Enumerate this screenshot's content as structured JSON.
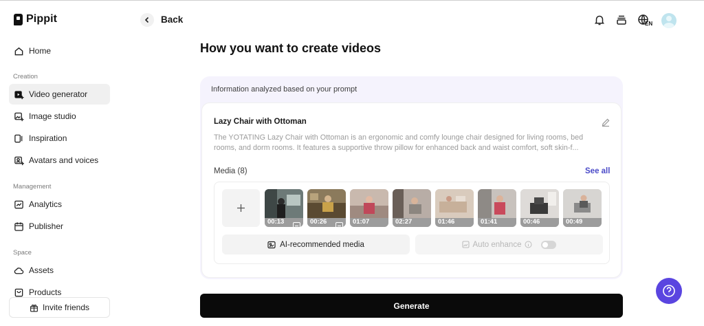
{
  "brand": {
    "name": "Pippit"
  },
  "sidebar": {
    "home": "Home",
    "sections": {
      "creation": "Creation",
      "management": "Management",
      "space": "Space"
    },
    "items": {
      "video_generator": "Video generator",
      "image_studio": "Image studio",
      "inspiration": "Inspiration",
      "avatars_voices": "Avatars and voices",
      "analytics": "Analytics",
      "publisher": "Publisher",
      "assets": "Assets",
      "products": "Products"
    },
    "active_item": "Video generator",
    "invite_label": "Invite friends"
  },
  "header": {
    "back_label": "Back",
    "language_badge": "EN",
    "icons": [
      "bell-icon",
      "stack-icon",
      "globe-icon",
      "avatar"
    ]
  },
  "main": {
    "title": "How you want to create videos",
    "info_header": "Information analyzed based on your prompt",
    "product": {
      "title": "Lazy Chair with Ottoman",
      "description_line1": "The YOTATING Lazy Chair with Ottoman is an ergonomic and comfy lounge chair designed for living rooms, bed",
      "description_line2": "rooms, and dorm rooms. It features a supportive throw pillow for enhanced back and waist comfort, soft skin-f..."
    },
    "media": {
      "label": "Media (8)",
      "see_all": "See all",
      "items": [
        {
          "duration": "00:13",
          "has_subtitle_icon": true
        },
        {
          "duration": "00:26",
          "has_subtitle_icon": true
        },
        {
          "duration": "01:07",
          "has_subtitle_icon": false
        },
        {
          "duration": "02:27",
          "has_subtitle_icon": false
        },
        {
          "duration": "01:46",
          "has_subtitle_icon": false
        },
        {
          "duration": "01:41",
          "has_subtitle_icon": false
        },
        {
          "duration": "00:46",
          "has_subtitle_icon": false
        },
        {
          "duration": "00:49",
          "has_subtitle_icon": false
        }
      ]
    },
    "ai_recommended_label": "AI-recommended media",
    "auto_enhance_label": "Auto enhance",
    "auto_enhance_on": false,
    "generate_label": "Generate"
  },
  "colors": {
    "accent": "#4a4ac8",
    "help_button": "#5a45e0",
    "panel_bg": "#f5f3fd",
    "generate_bg": "#0a0a0a"
  }
}
